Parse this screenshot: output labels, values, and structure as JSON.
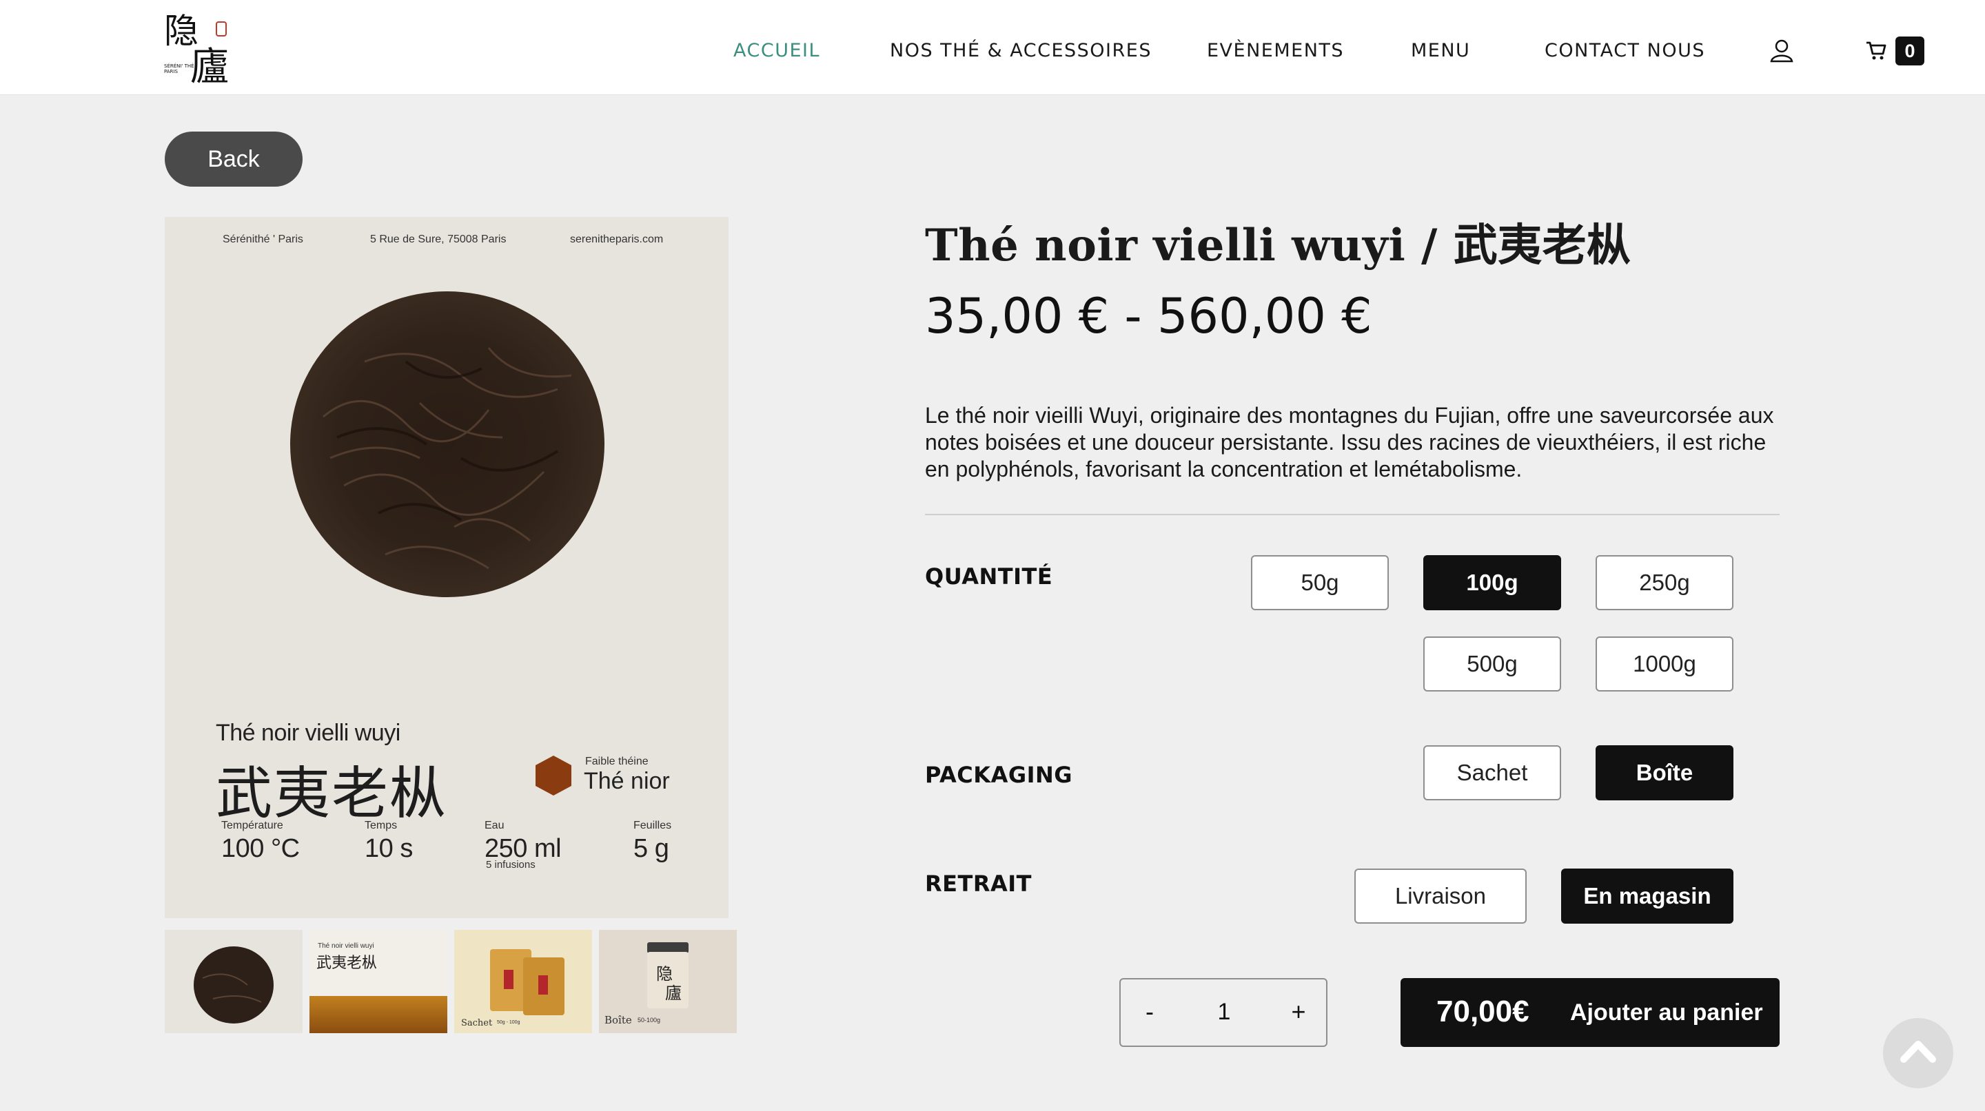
{
  "header": {
    "logo_alt": "Sérénithé Paris",
    "nav": [
      {
        "label": "ACCUEIL",
        "active": true
      },
      {
        "label": "NOS THÉ & ACCESSOIRES",
        "active": false
      },
      {
        "label": "EVÈNEMENTS",
        "active": false
      },
      {
        "label": "MENU",
        "active": false
      },
      {
        "label": "CONTACT NOUS",
        "active": false
      }
    ],
    "cart_count": "0",
    "user_icon": "user-icon",
    "cart_icon": "cart-icon"
  },
  "back_label": "Back",
  "product_card": {
    "top_left": "Sérénithé ' Paris",
    "top_center": "5 Rue de Sure, 75008 Paris",
    "top_right": "serenitheparis.com",
    "name": "Thé noir vielli wuyi",
    "name_cn": "武夷老枞",
    "theine": "Faible théine",
    "type": "Thé nior",
    "stats": [
      {
        "label": "Température",
        "value": "100 °C",
        "sub": ""
      },
      {
        "label": "Temps",
        "value": "10 s",
        "sub": ""
      },
      {
        "label": "Eau",
        "value": "250 ml",
        "sub": "5 infusions"
      },
      {
        "label": "Feuilles",
        "value": "5 g",
        "sub": ""
      }
    ]
  },
  "thumbnails": {
    "t2_name": "Thé noir vielli wuyi",
    "t2_cn": "武夷老枞",
    "t3_label": "Sachet",
    "t3_sub": "50g - 100g",
    "t4_label": "Boîte",
    "t4_sub": "50-100g"
  },
  "product": {
    "title": "Thé noir vielli wuyi / 武夷老枞",
    "price_range": "35,00 € - 560,00 €",
    "description": "Le thé noir vieilli Wuyi, originaire des montagnes du Fujian, offre une saveurcorsée aux notes boisées et une douceur persistante. Issu des racines de vieuxthéiers, il est riche en polyphénols, favorisant la concentration et lemétabolisme."
  },
  "options": {
    "quantity_label": "QUANTITÉ",
    "quantities": [
      {
        "label": "50g",
        "selected": false
      },
      {
        "label": "100g",
        "selected": true
      },
      {
        "label": "250g",
        "selected": false
      },
      {
        "label": "500g",
        "selected": false
      },
      {
        "label": "1000g",
        "selected": false
      }
    ],
    "packaging_label": "PACKAGING",
    "packaging": [
      {
        "label": "Sachet",
        "selected": false
      },
      {
        "label": "Boîte",
        "selected": true
      }
    ],
    "retrait_label": "RETRAIT",
    "retrait": [
      {
        "label": "Livraison",
        "selected": false
      },
      {
        "label": "En magasin",
        "selected": true
      }
    ]
  },
  "cart": {
    "minus": "-",
    "quantity": "1",
    "plus": "+",
    "total": "70,00€",
    "add_label": "Ajouter au panier"
  },
  "colors": {
    "accent": "#3b8f7f",
    "primary": "#111111",
    "hexagon": "#8a3c10"
  }
}
